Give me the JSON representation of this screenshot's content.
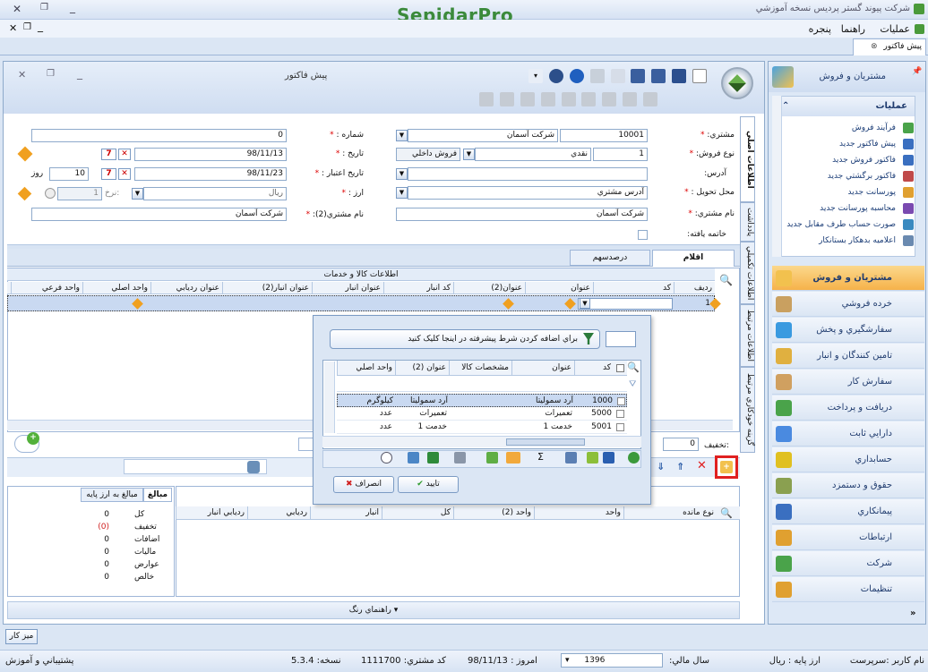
{
  "app": {
    "title": "شرکت پیوند گستر پردیس نسخه آموزشي",
    "brand": "SepidarPro"
  },
  "menu": [
    "عمليات",
    "راهنما",
    "پنجره"
  ],
  "doc_tab": "پيش فاکتور",
  "window": {
    "title": "پيش فاکتور"
  },
  "form": {
    "customer_label": "مشتري:",
    "customer_code": "10001",
    "customer_name": "شرکت آسمان",
    "sale_type_label": "نوع فروش:",
    "sale_type_code": "1",
    "sale_type_name": "نقدي",
    "sale_kind": "فروش داخلي",
    "address_label": "آدرس:",
    "address": "",
    "delivery_label": "محل تحويل :",
    "delivery": "آدرس مشتري",
    "customer_name_label": "نام مشتري:",
    "customer_name_value": "شرکت آسمان",
    "closed_label": "خاتمه يافته:",
    "number_label": "شماره :",
    "number": "0",
    "date_label": "تاريخ :",
    "date": "98/11/13",
    "validity_label": "تاريخ اعتبار :",
    "validity_date": "98/11/23",
    "days": "10",
    "days_unit": "روز",
    "currency_label": "ارز :",
    "currency": "ريال",
    "rate_label": "نرخ:",
    "rate": "1",
    "customer2_label": "نام مشتري(2):",
    "customer2": "شرکت آسمان"
  },
  "vtabs": [
    "اطلاعات اصلي",
    "يادداشت",
    "اطلاعات تکميلي",
    "اطلاعات مرتبط",
    "گزينه خودکاري مرتبط"
  ],
  "items_tabs": [
    "اقلام",
    "درصدسهم"
  ],
  "grid": {
    "group_header": "اطلاعات کالا و خدمات",
    "columns": [
      "رديف",
      "کد",
      "عنوان",
      "عنوان(2)",
      "کد انبار",
      "عنوان انبار",
      "عنوان انبار(2)",
      "عنوان رديابي",
      "واحد اصلي",
      "واحد فرعي"
    ],
    "row_num": "1"
  },
  "discount_label": "تخفيف:",
  "discount": "0",
  "popup": {
    "filter_prompt": "براي اضافه كردن شرط پيشرفته در اينجا كليک كنيد",
    "columns": [
      "کد",
      "عنوان",
      "مشخصات کالا",
      "عنوان (2)",
      "واحد اصلي"
    ],
    "rows": [
      {
        "code": "1000",
        "title": "آرد سموليتا",
        "spec": "",
        "title2": "آرد سموليتا",
        "unit": "كيلوگرم"
      },
      {
        "code": "5000",
        "title": "تعميرات",
        "spec": "",
        "title2": "تعميرات",
        "unit": "عدد"
      },
      {
        "code": "5001",
        "title": "خدمت 1",
        "spec": "",
        "title2": "خدمت 1",
        "unit": "عدد"
      }
    ],
    "ok": "تاييد",
    "cancel": "انصراف"
  },
  "totals": {
    "tabs": [
      "مبالغ",
      "مبالغ به ارز پايه"
    ],
    "rows": [
      {
        "label": "کل",
        "value": "0"
      },
      {
        "label": "تخفيف",
        "value": "(0)"
      },
      {
        "label": "اضافات",
        "value": "0"
      },
      {
        "label": "ماليات",
        "value": "0"
      },
      {
        "label": "عوارض",
        "value": "0"
      },
      {
        "label": "خالص",
        "value": "0"
      }
    ]
  },
  "stock_columns": [
    "نوع مانده",
    "واحد",
    "واحد (2)",
    "کل",
    "انبار",
    "رديابي",
    "رديابي انبار"
  ],
  "color_guide": "راهنماي رنگ",
  "sidebar": {
    "header": "مشتريان و فروش",
    "ops_title": "عمليات",
    "ops": [
      "فرآيند فروش",
      "پيش فاکتور جديد",
      "فاکتور فروش جديد",
      "فاکتور برگشتي جديد",
      "پورسانت جديد",
      "محاسبه پورسانت جديد",
      "صورت حساب طرف مقابل جديد",
      "اعلاميه بدهکار بستانکار"
    ],
    "modules": [
      "مشتريان و فروش",
      "خرده فروشي",
      "سفارشگيري و پخش",
      "تامين کنندگان و انبار",
      "سفارش کار",
      "دريافت و پرداخت",
      "دارايي ثابت",
      "حسابداري",
      "حقوق و دستمزد",
      "پيمانکاري",
      "ارتباطات",
      "شرکت",
      "تنظيمات"
    ]
  },
  "taskbar": "ميز کار",
  "status": {
    "user": "نام کاربر :سرپرست",
    "base_currency": "ارز پايه : ريال",
    "fiscal_year_label": "سال مالي:",
    "fiscal_year": "1396",
    "today": "امروز : 98/11/13",
    "customer_code": "كد مشتري: 1111700",
    "version": "نسخه: 5.3.4",
    "support": "پشتيباني و آموزش"
  },
  "colors": {
    "accent": "#f6b24a",
    "highlight": "#e02020",
    "panel": "#dbe6f4",
    "header": "#c9daf1"
  }
}
